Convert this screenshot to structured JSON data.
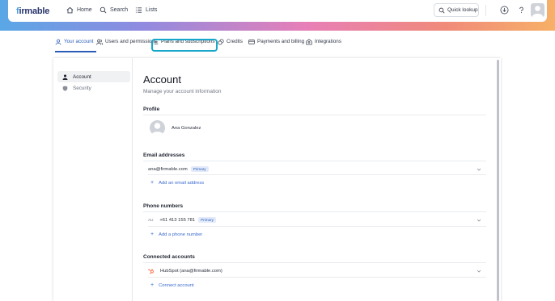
{
  "brand": {
    "logo_text": "firmable",
    "accent": "#2b5db8",
    "link_color": "#3b6bd0"
  },
  "topbar": {
    "nav": [
      {
        "label": "Home",
        "icon": "home-icon"
      },
      {
        "label": "Search",
        "icon": "search-icon"
      },
      {
        "label": "Lists",
        "icon": "list-icon"
      }
    ],
    "quick_lookup": "Quick lookup",
    "icons": [
      "download-icon",
      "help-icon",
      "avatar"
    ]
  },
  "tabs": [
    {
      "label": "Your account",
      "icon": "user-icon",
      "active": true
    },
    {
      "label": "Users and permissions",
      "icon": "users-icon"
    },
    {
      "label": "Plans and subscriptions",
      "icon": "list-icon",
      "highlighted": true
    },
    {
      "label": "Credits",
      "icon": "coins-icon"
    },
    {
      "label": "Payments and billing",
      "icon": "card-icon"
    },
    {
      "label": "Integrations",
      "icon": "puzzle-icon"
    }
  ],
  "sidebar": {
    "items": [
      {
        "label": "Account",
        "icon": "person-icon",
        "active": true
      },
      {
        "label": "Security",
        "icon": "shield-icon"
      }
    ]
  },
  "account": {
    "title": "Account",
    "subtitle": "Manage your account information",
    "profile": {
      "section_title": "Profile",
      "name": "Ana Gonzalez"
    },
    "email": {
      "section_title": "Email addresses",
      "value": "ana@firmable.com",
      "badge": "Primary",
      "add_label": "Add an email address"
    },
    "phone": {
      "section_title": "Phone numbers",
      "country_code": "AU",
      "value": "+61 413 155 781",
      "badge": "Primary",
      "add_label": "Add a phone number"
    },
    "connected": {
      "section_title": "Connected accounts",
      "value": "HubSpot (ana@firmable.com)",
      "icon": "hubspot-icon",
      "add_label": "Connect account"
    }
  }
}
